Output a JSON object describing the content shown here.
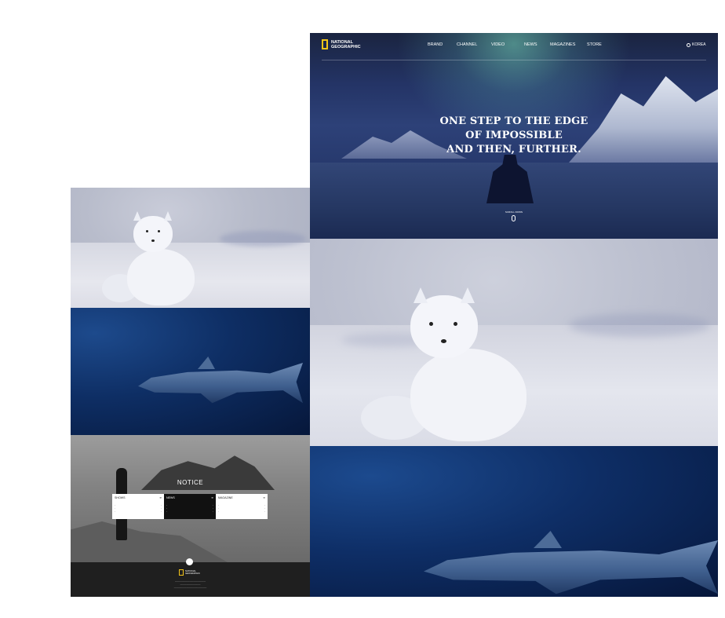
{
  "colors": {
    "brand_yellow": "#f5c518",
    "hero_blue": "#243466",
    "ocean_blue": "#0e2e64",
    "footer_bg": "#1f1f1f"
  },
  "header": {
    "logo_icon": "national-geographic-yellow-frame",
    "logo_line1": "NATIONAL",
    "logo_line2": "GEOGRAPHIC",
    "nav": [
      "BRAND",
      "CHANNEL",
      "VIDEO",
      "NEWS",
      "MAGAZINES",
      "STORE"
    ],
    "lang_icon": "globe-icon",
    "lang": "KOREA"
  },
  "hero": {
    "title_line1": "ONE STEP TO THE EDGE",
    "title_line2": "OF IMPOSSIBLE",
    "title_line3": "AND THEN, FURTHER.",
    "scroll_label": "SCROLL DOWN"
  },
  "notice": {
    "title": "NOTICE",
    "cards": [
      {
        "title": "SHOWS",
        "rows": [
          [
            "·",
            "·"
          ],
          [
            "·",
            "·"
          ],
          [
            "·",
            "·"
          ]
        ]
      },
      {
        "title": "NEWS",
        "rows": [
          [
            "·",
            "·"
          ],
          [
            "·",
            "·"
          ],
          [
            "·",
            "·"
          ]
        ]
      },
      {
        "title": "MAGAZINE",
        "rows": [
          [
            "·",
            "·"
          ],
          [
            "·",
            "·"
          ],
          [
            "·",
            "·"
          ]
        ]
      }
    ]
  },
  "footer": {
    "logo_line1": "NATIONAL",
    "logo_line2": "GEOGRAPHIC"
  }
}
